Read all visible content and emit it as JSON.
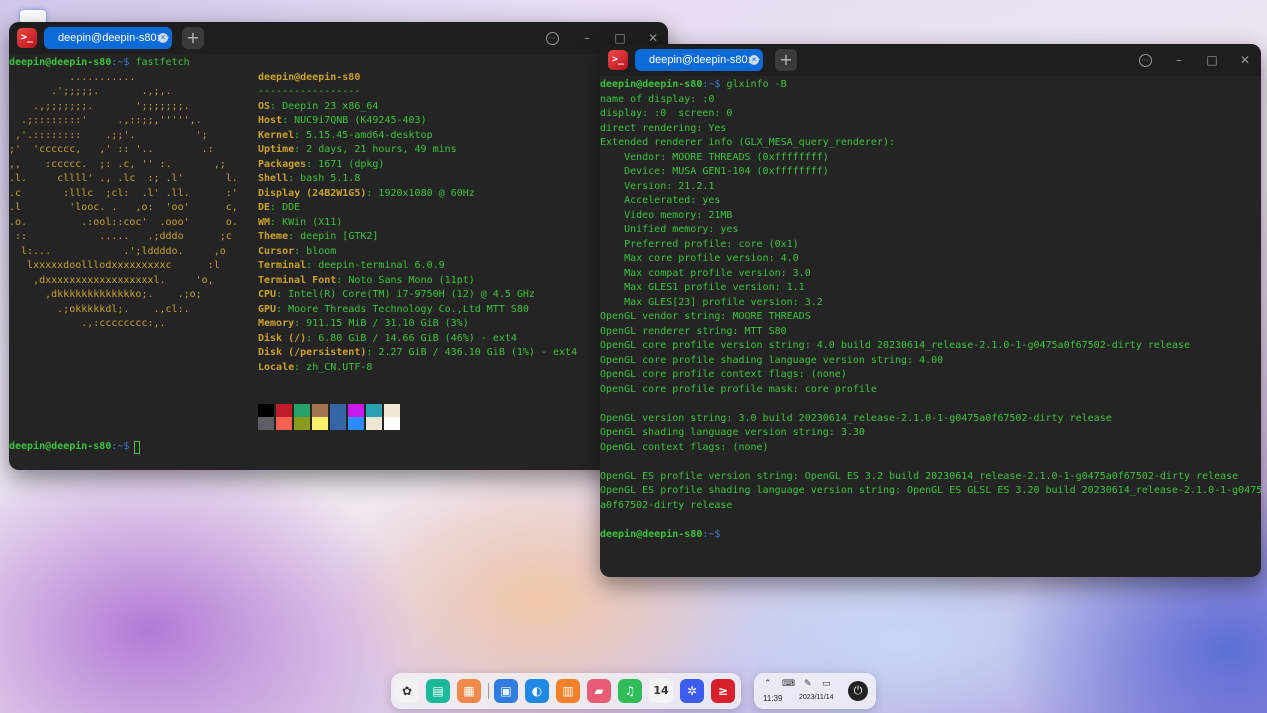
{
  "desktop": {
    "top_icon": "blank-icon"
  },
  "term1": {
    "tab_title": "deepin@deepin-s80: ~",
    "prompt_user": "deepin@deepin-s80",
    "prompt_path": ":~$ ",
    "command": "fastfetch",
    "logo": [
      "          ...........",
      "       .';;;;;.       .,;,.",
      "    .,;;;;;;;.       ';;;;;;;.",
      "  .;::::::::'     .,::;;,''''',.",
      " ,'.::::::::    .;;'.          ';",
      ";'  'cccccc,   ,' :: '..        .:",
      ",,    :ccccc.  ;: .c, '' :.       ,;",
      ".l.     cllll' ., .lc  :; .l'       l.",
      ".c       :lllc  ;cl:  .l' .ll.      :'",
      ".l        'looc. .   ,o:  'oo'      c,",
      ".o.         .:ool::coc'  .ooo'      o.",
      " ::            .....   .;dddo      ;c",
      "  l:...            .';lddddo.     ,o",
      "   lxxxxxdoolllodxxxxxxxxxc      :l",
      "    ,dxxxxxxxxxxxxxxxxxxl.     'o,",
      "      ,dkkkkkkkkkkkkko;.    .;o;",
      "        .;okkkkkdl;.    .,cl:.",
      "            .,:cccccccc:,."
    ],
    "info_header": "deepin@deepin-s80",
    "info_sep": "-----------------",
    "info": [
      {
        "k": "OS",
        "v": "Deepin 23 x86_64"
      },
      {
        "k": "Host",
        "v": "NUC9i7QNB (K49245-403)"
      },
      {
        "k": "Kernel",
        "v": "5.15.45-amd64-desktop"
      },
      {
        "k": "Uptime",
        "v": "2 days, 21 hours, 49 mins"
      },
      {
        "k": "Packages",
        "v": "1671 (dpkg)"
      },
      {
        "k": "Shell",
        "v": "bash 5.1.8"
      },
      {
        "k": "Display (24B2W1G5)",
        "v": "1920x1080 @ 60Hz"
      },
      {
        "k": "DE",
        "v": "DDE"
      },
      {
        "k": "WM",
        "v": "KWin (X11)"
      },
      {
        "k": "Theme",
        "v": "deepin [GTK2]"
      },
      {
        "k": "Cursor",
        "v": "bloom"
      },
      {
        "k": "Terminal",
        "v": "deepin-terminal 6.0.9"
      },
      {
        "k": "Terminal Font",
        "v": "Noto Sans Mono (11pt)"
      },
      {
        "k": "CPU",
        "v": "Intel(R) Core(TM) i7-9750H (12) @ 4.5 GHz"
      },
      {
        "k": "GPU",
        "v": "Moore Threads Technology Co.,Ltd MTT S80"
      },
      {
        "k": "Memory",
        "v": "911.15 MiB / 31.10 GiB (3%)"
      },
      {
        "k": "Disk (/)",
        "v": "6.80 GiB / 14.66 GiB (46%) - ext4"
      },
      {
        "k": "Disk (/persistent)",
        "v": "2.27 GiB / 436.10 GiB (1%) - ext4"
      },
      {
        "k": "Locale",
        "v": "zh_CN.UTF-8"
      }
    ],
    "palette_top": [
      "#000000",
      "#c01c28",
      "#26a269",
      "#a2734c",
      "#3465a4",
      "#c61aef",
      "#2aa1b3",
      "#f0e6d2"
    ],
    "palette_bottom": [
      "#5e5c64",
      "#f66151",
      "#8a9a1a",
      "#f9f06b",
      "#3465a4",
      "#2a8cff",
      "#f0e6d2",
      "#ffffff"
    ]
  },
  "term2": {
    "tab_title": "deepin@deepin-s80: ~",
    "prompt_user": "deepin@deepin-s80",
    "prompt_path": ":~$ ",
    "command": "glxinfo -B",
    "output": [
      "name of display: :0",
      "display: :0  screen: 0",
      "direct rendering: Yes",
      "Extended renderer info (GLX_MESA_query_renderer):",
      "    Vendor: MOORE THREADS (0xffffffff)",
      "    Device: MUSA GEN1-104 (0xffffffff)",
      "    Version: 21.2.1",
      "    Accelerated: yes",
      "    Video memory: 21MB",
      "    Unified memory: yes",
      "    Preferred profile: core (0x1)",
      "    Max core profile version: 4.0",
      "    Max compat profile version: 3.0",
      "    Max GLES1 profile version: 1.1",
      "    Max GLES[23] profile version: 3.2",
      "OpenGL vendor string: MOORE THREADS",
      "OpenGL renderer string: MTT S80",
      "OpenGL core profile version string: 4.0 build 20230614_release-2.1.0-1-g0475a0f67502-dirty release",
      "OpenGL core profile shading language version string: 4.00",
      "OpenGL core profile context flags: (none)",
      "OpenGL core profile profile mask: core profile",
      "",
      "OpenGL version string: 3.0 build 20230614_release-2.1.0-1-g0475a0f67502-dirty release",
      "OpenGL shading language version string: 3.30",
      "OpenGL context flags: (none)",
      "",
      "OpenGL ES profile version string: OpenGL ES 3.2 build 20230614_release-2.1.0-1-g0475a0f67502-dirty release",
      "OpenGL ES profile shading language version string: OpenGL ES GLSL ES 3.20 build 20230614_release-2.1.0-1-g0475",
      "a0f67502-dirty release"
    ]
  },
  "dock": {
    "apps": [
      {
        "name": "launcher-icon",
        "color": "#f2f2f2",
        "glyph": "✿"
      },
      {
        "name": "terminal-app-icon",
        "color": "#1bb89a",
        "glyph": "▤"
      },
      {
        "name": "multitasking-icon",
        "color": "#f08a4b",
        "glyph": "▦"
      },
      {
        "name": "file-manager-icon",
        "color": "#2f7de1",
        "glyph": "▣"
      },
      {
        "name": "browser-icon",
        "color": "#1e88e5",
        "glyph": "◐"
      },
      {
        "name": "app-store-icon",
        "color": "#f5802a",
        "glyph": "▥"
      },
      {
        "name": "photos-icon",
        "color": "#e85d75",
        "glyph": "▰"
      },
      {
        "name": "music-icon",
        "color": "#2ebd59",
        "glyph": "♫"
      },
      {
        "name": "calendar-icon",
        "color": "#f4f4f4",
        "glyph": "14"
      },
      {
        "name": "settings-icon",
        "color": "#3d5af1",
        "glyph": "✲"
      },
      {
        "name": "deepin-terminal-icon",
        "color": "#d8202c",
        "glyph": "≥"
      }
    ],
    "calendar_day": "14"
  },
  "tray": {
    "time": "11:39",
    "date": "2023/11/14"
  }
}
